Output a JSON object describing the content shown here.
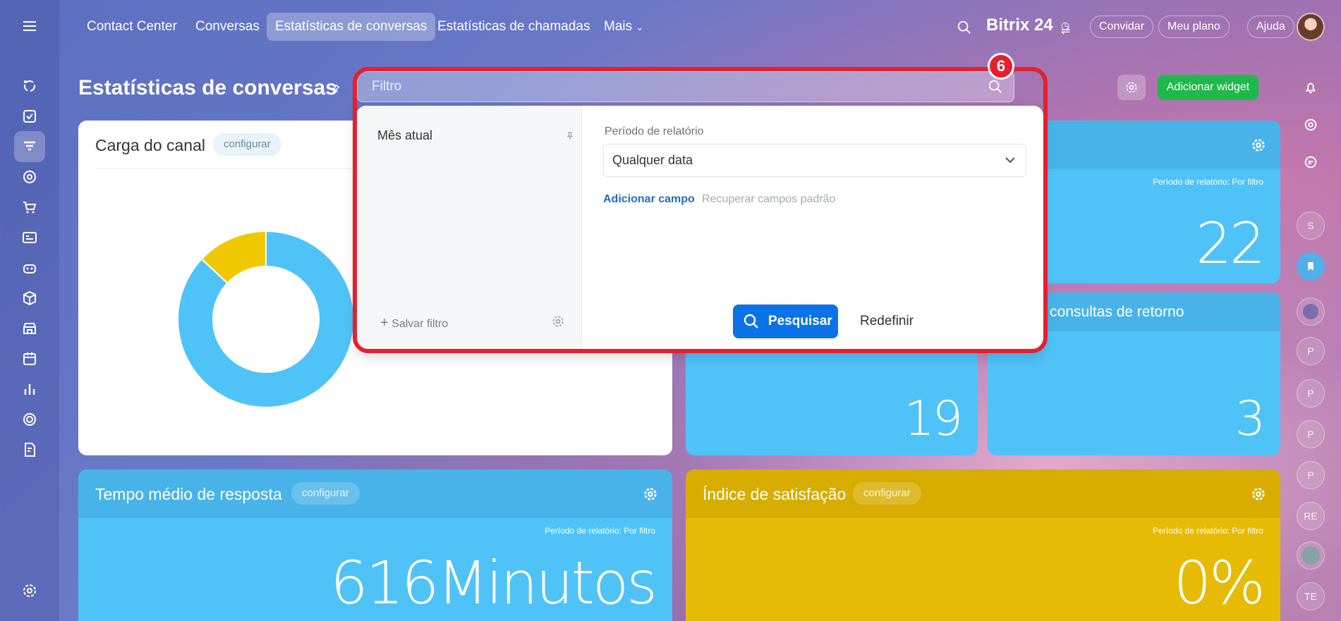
{
  "nav": {
    "items": [
      "Contact Center",
      "Conversas",
      "Estatísticas de conversas",
      "Estatísticas de chamadas",
      "Mais"
    ],
    "brand": "Bitrix 24",
    "invite": "Convidar",
    "plan": "Meu plano",
    "help": "Ajuda"
  },
  "page": {
    "title": "Estatísticas de conversas",
    "add_widget": "Adicionar widget"
  },
  "filter": {
    "placeholder": "Filtro",
    "preset": "Mês atual",
    "save_filter": "Salvar filtro",
    "field_label": "Período de relatório",
    "field_value": "Qualquer data",
    "add_field": "Adicionar campo",
    "restore_fields": "Recuperar campos padrão",
    "search_button": "Pesquisar",
    "reset_button": "Redefinir",
    "step_badge": "6"
  },
  "widgets": {
    "channel_load": {
      "title": "Carga do canal",
      "configure": "configurar",
      "chart_data": {
        "type": "pie",
        "categories": [
          "blue segment",
          "yellow segment"
        ],
        "values": [
          87,
          13
        ],
        "colors": [
          "#4fc3f7",
          "#f0c800"
        ]
      }
    },
    "top_right": {
      "period": "Período de relatório: Por filtro",
      "value": "22"
    },
    "middle_left": {
      "value": "19"
    },
    "middle_right": {
      "title_fragment": "s, consultas de retorno",
      "value": "3"
    },
    "response_time": {
      "title": "Tempo médio de resposta",
      "configure": "configurar",
      "period": "Período de relatório: Por filtro",
      "value": "616Minutos"
    },
    "satisfaction": {
      "title": "Índice de satisfação",
      "configure": "configurar",
      "period": "Período de relatório: Por filtro",
      "value": "0%"
    }
  },
  "right_rail": {
    "letters": [
      "S",
      "P",
      "P",
      "P",
      "P",
      "RE",
      "TE"
    ]
  },
  "colors": {
    "accent_blue": "#0b72e7",
    "green": "#1fb84a",
    "widget_blue": "#4fc3f7",
    "widget_yellow": "#e6bb05",
    "highlight_red": "#e5202e"
  }
}
